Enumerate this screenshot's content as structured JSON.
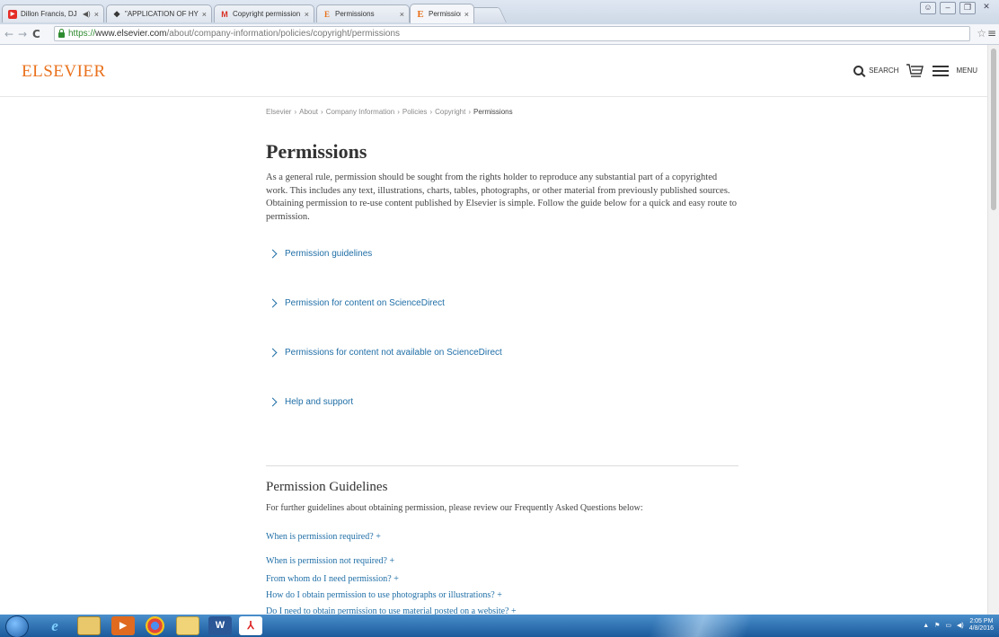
{
  "browser": {
    "tabs": [
      {
        "title": "Dillon Francis, DJ Snake",
        "favicon": "youtube-icon",
        "audio": true
      },
      {
        "title": "\"APPLICATION OF HYDRC",
        "favicon": "document-icon"
      },
      {
        "title": "Copyright permission - ar",
        "favicon": "gmail-icon"
      },
      {
        "title": "Permissions",
        "favicon": "elsevier-icon"
      },
      {
        "title": "Permissions",
        "favicon": "elsevier-icon",
        "active": true
      }
    ],
    "url": {
      "scheme": "https://",
      "host": "www.elsevier.com",
      "path": "/about/company-information/policies/copyright/permissions"
    }
  },
  "header": {
    "logo": "ELSEVIER",
    "search_label": "SEARCH",
    "menu_label": "MENU"
  },
  "breadcrumb": [
    {
      "label": "Elsevier"
    },
    {
      "label": "About"
    },
    {
      "label": "Company Information"
    },
    {
      "label": "Policies"
    },
    {
      "label": "Copyright"
    },
    {
      "label": "Permissions",
      "current": true
    }
  ],
  "breadcrumb_separator": "›",
  "main": {
    "title": "Permissions",
    "intro": "As a general rule, permission should be sought from the rights holder to reproduce any substantial part of a copyrighted work. This includes any text, illustrations, charts, tables, photographs, or other material from previously published sources. Obtaining permission to re-use content published by Elsevier is simple. Follow the guide below for a quick and easy route to permission.",
    "accordion": [
      "Permission guidelines",
      "Permission for content on ScienceDirect",
      "Permissions for content not available on ScienceDirect",
      "Help and support"
    ]
  },
  "guidelines": {
    "heading": "Permission Guidelines",
    "subtitle": "For further guidelines about obtaining permission, please review our Frequently Asked Questions below:",
    "faqs": [
      "When is permission required? +",
      "When is permission not required? +",
      "From whom do I need permission? +",
      "How do I obtain permission to use photographs or illustrations? +",
      "Do I need to obtain permission to use material posted on a website? +"
    ]
  },
  "taskbar": {
    "clock_time": "2:05 PM",
    "clock_date": "4/8/2016",
    "apps": [
      "internet-explorer-icon",
      "file-explorer-icon",
      "media-player-icon",
      "chrome-icon",
      "folder-icon",
      "word-icon",
      "acrobat-icon"
    ]
  },
  "colors": {
    "brand": "#e9711c",
    "link": "#1f6ea6",
    "taskbar": "#1b5b9c"
  }
}
